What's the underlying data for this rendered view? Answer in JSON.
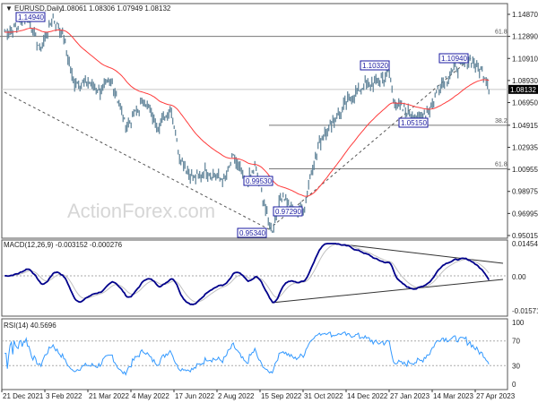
{
  "chart_data": {
    "type": "candlestick-bar",
    "symbol_title": "EURUSD,Daily",
    "ohlc_readout": "1.08061 1.08306 1.07949 1.08132",
    "last_price": "1.08132",
    "watermark": "ActionForex.com",
    "price_ticks": [
      "1.14870",
      "1.12890",
      "1.10910",
      "1.08930",
      "1.06950",
      "1.04915",
      "1.02935",
      "1.00955",
      "0.98975",
      "0.96995",
      "0.95015"
    ],
    "price_range": [
      0.95015,
      1.1487
    ],
    "date_ticks": [
      "21 Dec 2021",
      "3 Feb 2022",
      "21 Mar 2022",
      "4 May 2022",
      "17 Jun 2022",
      "2 Aug 2022",
      "15 Sep 2022",
      "31 Oct 2022",
      "14 Dec 2022",
      "27 Jan 2023",
      "14 Mar 2023",
      "27 Apr 2023"
    ],
    "approx_closes": [
      [
        "2021-12-24",
        1.1327
      ],
      [
        "2022-01-07",
        1.138
      ],
      [
        "2022-01-16",
        1.149
      ],
      [
        "2022-01-30",
        1.117
      ],
      [
        "2022-02-12",
        1.146
      ],
      [
        "2022-02-23",
        1.129
      ],
      [
        "2022-03-05",
        1.088
      ],
      [
        "2022-03-19",
        1.088
      ],
      [
        "2022-04-02",
        1.08
      ],
      [
        "2022-04-15",
        1.088
      ],
      [
        "2022-04-29",
        1.048
      ],
      [
        "2022-05-18",
        1.072
      ],
      [
        "2022-06-01",
        1.048
      ],
      [
        "2022-06-15",
        1.064
      ],
      [
        "2022-06-24",
        1.02
      ],
      [
        "2022-07-08",
        1.0
      ],
      [
        "2022-07-22",
        1.008
      ],
      [
        "2022-08-09",
        1.0
      ],
      [
        "2022-08-19",
        1.02
      ],
      [
        "2022-09-01",
        0.996
      ],
      [
        "2022-09-10",
        1.012
      ],
      [
        "2022-09-24",
        0.963
      ],
      [
        "2022-09-28",
        0.955
      ],
      [
        "2022-10-08",
        0.987
      ],
      [
        "2022-10-22",
        0.971
      ],
      [
        "2022-10-31",
        0.975
      ],
      [
        "2022-11-09",
        1.012
      ],
      [
        "2022-11-19",
        1.04
      ],
      [
        "2022-12-03",
        1.056
      ],
      [
        "2022-12-17",
        1.072
      ],
      [
        "2022-12-31",
        1.084
      ],
      [
        "2023-01-14",
        1.088
      ],
      [
        "2023-01-28",
        1.096
      ],
      [
        "2023-02-01",
        1.072
      ],
      [
        "2023-02-15",
        1.06
      ],
      [
        "2023-03-01",
        1.056
      ],
      [
        "2023-03-11",
        1.064
      ],
      [
        "2023-03-20",
        1.084
      ],
      [
        "2023-04-03",
        1.096
      ],
      [
        "2023-04-13",
        1.104
      ],
      [
        "2023-04-22",
        1.108
      ],
      [
        "2023-05-06",
        1.096
      ],
      [
        "2023-05-12",
        1.0813
      ]
    ],
    "swing_labels": [
      "1.14940",
      "1.10320",
      "1.10940",
      "1.05150",
      "0.99530",
      "0.97290",
      "0.95340"
    ],
    "fib_labels": [
      "61.8",
      "38.2",
      "61.8"
    ],
    "fib_levels": [
      1.1289,
      1.0491,
      1.01
    ],
    "colors": {
      "bars": "#5a7f95",
      "ma": "#ff3b3b",
      "macd": "#00008b",
      "signal": "#c0c0c0",
      "rsi": "#3399ff",
      "label_box": "#1a1aa0"
    },
    "macd": {
      "title": "MACD(12,26,9) -0.003152 -0.000276",
      "ticks": [
        "0.014549",
        "0.00",
        "-0.015712"
      ],
      "range": [
        -0.015712,
        0.014549
      ]
    },
    "rsi": {
      "title": "RSI(14) 40.5696",
      "ticks": [
        "100",
        "70",
        "30",
        "0"
      ],
      "range": [
        0,
        100
      ]
    }
  }
}
